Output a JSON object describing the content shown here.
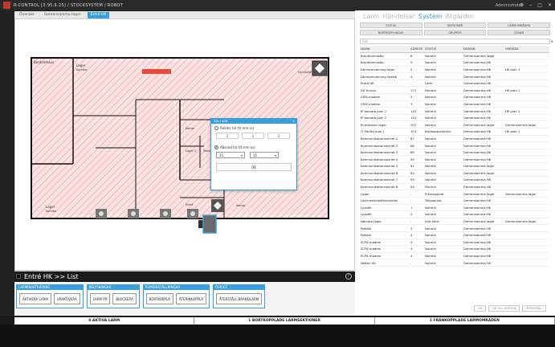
{
  "titlebar": {
    "title": "R-CONTROL [3.95.6.25] / STOCKSYSTEM / ROBOT",
    "user": "Administrator"
  },
  "tabs": [
    "Översikt",
    "Gemensamma lager",
    "Entré HK"
  ],
  "map": {
    "rooms": [
      "Bootomhaus",
      "Lager",
      "Korridor",
      "Kontor",
      "Lager 2",
      "Lager",
      "Korridor",
      "Entré",
      "Toalett",
      "Lager",
      "Anläggning",
      "Kontor",
      "Lager"
    ],
    "alarm_label": "Larmsektion"
  },
  "dialog": {
    "title": "Sätt i drift",
    "opt1": "Relativ tid (tt:mm:ss)",
    "inputs": [
      "1",
      "1",
      "1"
    ],
    "opt2": "Absolut tid (tt:mm:ss)",
    "sel1": "15",
    "sel2": "15",
    "ok": "OK"
  },
  "crumb": "Entré HK >> List",
  "groups": [
    {
      "header": "LARMINAKTIVERING",
      "buttons": [
        "AKTIVERA LARM",
        "URAKTIVERA"
      ]
    },
    {
      "header": "BELYSNINGAR",
      "buttons": [
        "LARM PÅ",
        "BLOCKERA"
      ]
    },
    {
      "header": "RUMSINSTÄLLNINGAR",
      "buttons": [
        "BORTKOPPLA",
        "ÅTERINKOPPLA"
      ]
    },
    {
      "header": "ÖVRIGT",
      "buttons": [
        "ÅTERSTÄLL BRANDLARM"
      ]
    }
  ],
  "right": {
    "categories": [
      "Larm",
      "Händelser",
      "System",
      "Åtgärder"
    ],
    "active_category": "System",
    "filters": [
      "STATUS",
      "SEKTIONER",
      "LARMOMRÅDEN",
      "BORTKOPPLINGAR",
      "GRUPPER",
      "ZONER"
    ],
    "search_placeholder": "Sök",
    "columns": [
      "NAMN",
      "ADRESS",
      "STATUS",
      "DOMÄN",
      "OMRÅDE"
    ],
    "rows": [
      [
        "Brandlarmskåp",
        "8",
        "Normal",
        "Gemensamma lager",
        ""
      ],
      [
        "Brandlarmskåp",
        "5",
        "Normal",
        "Gemensamma HK",
        ""
      ],
      [
        "Dörrövervakning lager",
        "2",
        "Normal",
        "Gemensamma HK",
        "HK plan 1"
      ],
      [
        "Dörrövervakning lastkaj",
        "4",
        "Normal",
        "Gemensamma HK",
        ""
      ],
      [
        "Entré HK",
        "-",
        "Larm",
        "Gemensamma HK",
        ""
      ],
      [
        "GK Huvud",
        "172",
        "Normal",
        "Gemensamma HK",
        "HK plan 1"
      ],
      [
        "GSM-modem",
        "3",
        "Normal",
        "Gemensamma HK",
        ""
      ],
      [
        "GSM-modem",
        "3",
        "Normal",
        "Gemensamma HK",
        ""
      ],
      [
        "IP-kamera plan 1",
        "115",
        "Normal",
        "Gemensamma HK",
        "HK plan 1"
      ],
      [
        "IP-kamera plan 2",
        "112",
        "Normal",
        "Gemensamma HK",
        ""
      ],
      [
        "IR-detektor lager",
        "207",
        "Normal",
        "Gemensamma lager",
        "Gemensamma lager"
      ],
      [
        "IT Förråd plan 1",
        "101",
        "Bortkopplad/larm",
        "Gemensamma HK",
        "HK plan 1"
      ],
      [
        "Kommunikationsenhet 1",
        "87",
        "Normal",
        "Gemensamma HK",
        ""
      ],
      [
        "Kommunikationsenhet 2",
        "88",
        "Normal",
        "Gemensamma HK",
        ""
      ],
      [
        "Kommunikationsenhet 3",
        "89",
        "Normal",
        "Gemensamma HK",
        ""
      ],
      [
        "Kommunikationsenhet 4",
        "90",
        "Normal",
        "Gemensamma HK",
        ""
      ],
      [
        "Kommunikationsenhet 5",
        "91",
        "Normal",
        "Gemensamma lager",
        ""
      ],
      [
        "Kommunikationsenhet 6",
        "92",
        "Normal",
        "Gemensamma lager",
        ""
      ],
      [
        "Kommunikationsenhet 7",
        "93",
        "Normal",
        "Gemensamma HK",
        ""
      ],
      [
        "Kommunikationsenhet 8",
        "94",
        "Normal",
        "Gemensamma HK",
        ""
      ],
      [
        "Lager",
        "-",
        "Frånkopplad",
        "Gemensamma lager",
        "Gemensamma lager"
      ],
      [
        "Larmcentralsförbindelse",
        "-",
        "Tillkopplad",
        "Gemensamma HK",
        ""
      ],
      [
        "Ljusfält",
        "1",
        "Normal",
        "Gemensamma HK",
        ""
      ],
      [
        "Ljusfält",
        "2",
        "Normal",
        "Gemensamma HK",
        ""
      ],
      [
        "Närvaro lager",
        "-",
        "Inte aktiv",
        "Gemensamma lager",
        "Gemensamma lager"
      ],
      [
        "Rökdet",
        "3",
        "Normal",
        "Gemensamma HK",
        ""
      ],
      [
        "Rökdet",
        "4",
        "Normal",
        "Gemensamma HK",
        ""
      ],
      [
        "SCPA modem",
        "4",
        "Normal",
        "Gemensamma HK",
        ""
      ],
      [
        "SCPA modem",
        "4",
        "Normal",
        "Gemensamma HK",
        ""
      ],
      [
        "SCPA modem",
        "3",
        "Normal",
        "Gemensamma HK",
        ""
      ],
      [
        "Vatten HK",
        "-",
        "Normal",
        "Gemensamma HK",
        ""
      ]
    ],
    "footer": [
      "OK",
      "GÅ TILL SEKTION",
      "ÅTERSTÄLL"
    ]
  },
  "statusbar": [
    "0 AKTIVA LARM",
    "1 BORTKOPPLADE LARMSEKTIONER",
    "1 FRÅNKOPPLADE LARMOMRÅDEN"
  ]
}
